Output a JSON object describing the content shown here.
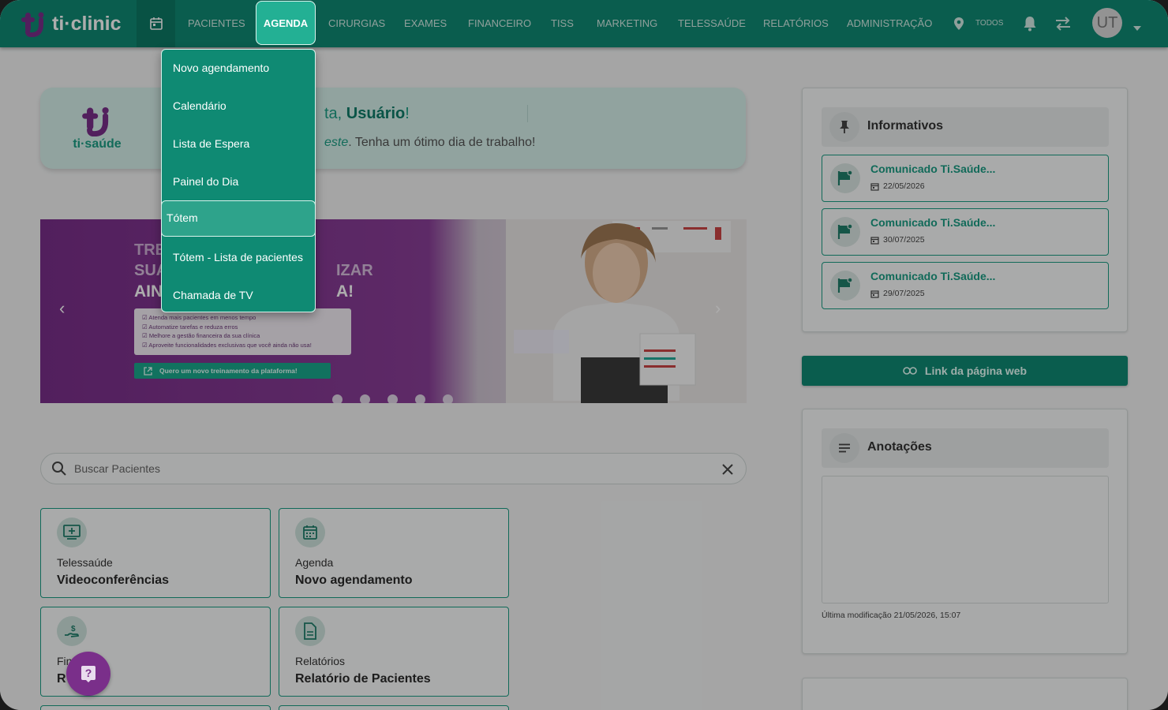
{
  "app": {
    "brand": "ti·clinic"
  },
  "nav": {
    "items": [
      "PACIENTES",
      "AGENDA",
      "CIRURGIAS",
      "EXAMES",
      "FINANCEIRO",
      "TISS",
      "MARKETING",
      "TELESSAÚDE",
      "RELATÓRIOS",
      "ADMINISTRAÇÃO"
    ],
    "active": "AGENDA",
    "location_label": "TODOS",
    "avatar_initials": "UT"
  },
  "agenda_menu": {
    "items": [
      "Novo agendamento",
      "Calendário",
      "Lista de Espera",
      "Painel do Dia",
      "Tótem",
      "Tótem - Lista de pacientes",
      "Chamada de TV"
    ],
    "highlighted": "Tótem"
  },
  "welcome": {
    "logo_text": "ti·saúde",
    "greeting_prefix": "ta, ",
    "greeting_name": "Usuário",
    "greeting_suffix": "!",
    "line2_highlight": "este",
    "line2_rest": ". Tenha um ótimo dia de trabalho!"
  },
  "banner": {
    "line1": "TRE",
    "line2": "SUA",
    "line3": "AIN",
    "line2_right": "IZAR",
    "line3_right": "A!",
    "bullets": [
      "Atenda mais pacientes em menos tempo",
      "Automatize tarefas e reduza erros",
      "Melhore a gestão financeira da sua clínica",
      "Aproveite funcionalidades exclusivas que você ainda não usa!"
    ],
    "cta": "Quero um novo treinamento da plataforma!",
    "slide_count": 5
  },
  "search": {
    "placeholder": "Buscar Pacientes"
  },
  "cards": [
    {
      "category": "Telessaúde",
      "title": "Videoconferências",
      "icon": "monitor-plus-icon"
    },
    {
      "category": "Agenda",
      "title": "Novo agendamento",
      "icon": "calendar-icon"
    },
    {
      "category": "Fin",
      "title": "R",
      "icon": "hand-coin-icon"
    },
    {
      "category": "Relatórios",
      "title": "Relatório de Pacientes",
      "icon": "document-icon"
    }
  ],
  "informativos": {
    "title": "Informativos",
    "items": [
      {
        "title": "Comunicado Ti.Saúde...",
        "date": "22/05/2026"
      },
      {
        "title": "Comunicado Ti.Saúde...",
        "date": "30/07/2025"
      },
      {
        "title": "Comunicado Ti.Saúde...",
        "date": "29/07/2025"
      }
    ]
  },
  "web_link": {
    "label": "Link da página web"
  },
  "notes": {
    "title": "Anotações",
    "last_modified": "Última modificação 21/05/2026, 15:07"
  },
  "colors": {
    "primary": "#0f8a73",
    "accent": "#23b094",
    "purple": "#7a2f8a"
  }
}
